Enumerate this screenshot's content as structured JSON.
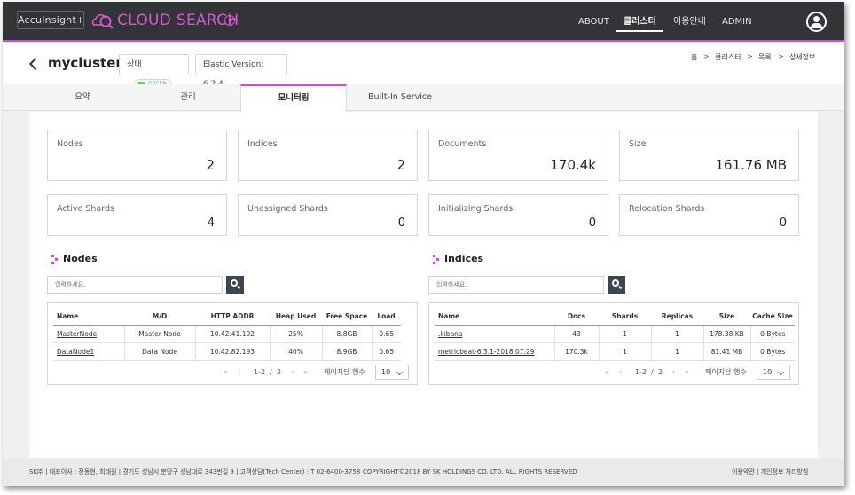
{
  "topbar": {
    "brand_box": "AccuInsight+",
    "brand_title": "CLOUD SEARCH",
    "nav": [
      "ABOUT",
      "클러스터",
      "이용안내",
      "ADMIN"
    ],
    "active_nav": "클러스터"
  },
  "header": {
    "cluster_name": "mycluster",
    "status_label": "상태",
    "status_value": "GREEN",
    "elastic_version": "Elastic Version: 6.2.4",
    "breadcrumb": [
      "홈",
      "클러스터",
      "목록",
      "상세정보"
    ]
  },
  "tabs": [
    "요약",
    "관리",
    "모니터링",
    "Built-In Service"
  ],
  "active_tab": "모니터링",
  "stats": [
    {
      "label": "Nodes",
      "value": "2"
    },
    {
      "label": "Indices",
      "value": "2"
    },
    {
      "label": "Documents",
      "value": "170.4k"
    },
    {
      "label": "Size",
      "value": "161.76 MB"
    },
    {
      "label": "Active Shards",
      "value": "4"
    },
    {
      "label": "Unassigned Shards",
      "value": "0"
    },
    {
      "label": "Initializing Shards",
      "value": "0"
    },
    {
      "label": "Relocation Shards",
      "value": "0"
    }
  ],
  "nodes": {
    "title": "Nodes",
    "search_placeholder": "입력하세요.",
    "columns": [
      "Name",
      "M/D",
      "HTTP ADDR",
      "Heap Used",
      "Free Space",
      "Load"
    ],
    "rows": [
      [
        "MasterNode",
        "Master Node",
        "10.42.41.192",
        "25%",
        "8.8GB",
        "0.65"
      ],
      [
        "DataNode1",
        "Data Node",
        "10.42.82.193",
        "40%",
        "8.9GB",
        "0.65"
      ]
    ],
    "pager": {
      "first": "«",
      "prev": "‹",
      "range": "1-2",
      "sep": "/",
      "total": "2",
      "next": "›",
      "last": "»",
      "per_page_label": "페이지당 행수",
      "per_page": "10"
    }
  },
  "indices": {
    "title": "Indices",
    "search_placeholder": "입력하세요.",
    "columns": [
      "Name",
      "Docs",
      "Shards",
      "Replicas",
      "Size",
      "Cache Size"
    ],
    "rows": [
      [
        ".kibana",
        "43",
        "1",
        "1",
        "178.38 KB",
        "0 Bytes"
      ],
      [
        "metricbeat-6.3.1-2018.07.29",
        "170.3k",
        "1",
        "1",
        "81.41 MB",
        "0 Bytes"
      ]
    ],
    "pager": {
      "first": "«",
      "prev": "‹",
      "range": "1-2",
      "sep": "/",
      "total": "2",
      "next": "›",
      "last": "»",
      "per_page_label": "페이지당 행수",
      "per_page": "10"
    }
  },
  "footer": {
    "left": "SK㈜ | 대표이사 : 장동현, 최태원 | 경기도 성남시 분당구 성남대로 343번길 9 | 고객상담(Tech Center) : T 02-6400-3758",
    "copyright": "COPYRIGHT©2018 BY SK HOLDINGS CO. LTD. ALL RIGHTS RESERVED",
    "right": "이용약관 | 개인정보 처리방침"
  },
  "colors": {
    "accent": "#c94fc6",
    "topbar": "#333438",
    "status_green": "#7cc47c"
  }
}
